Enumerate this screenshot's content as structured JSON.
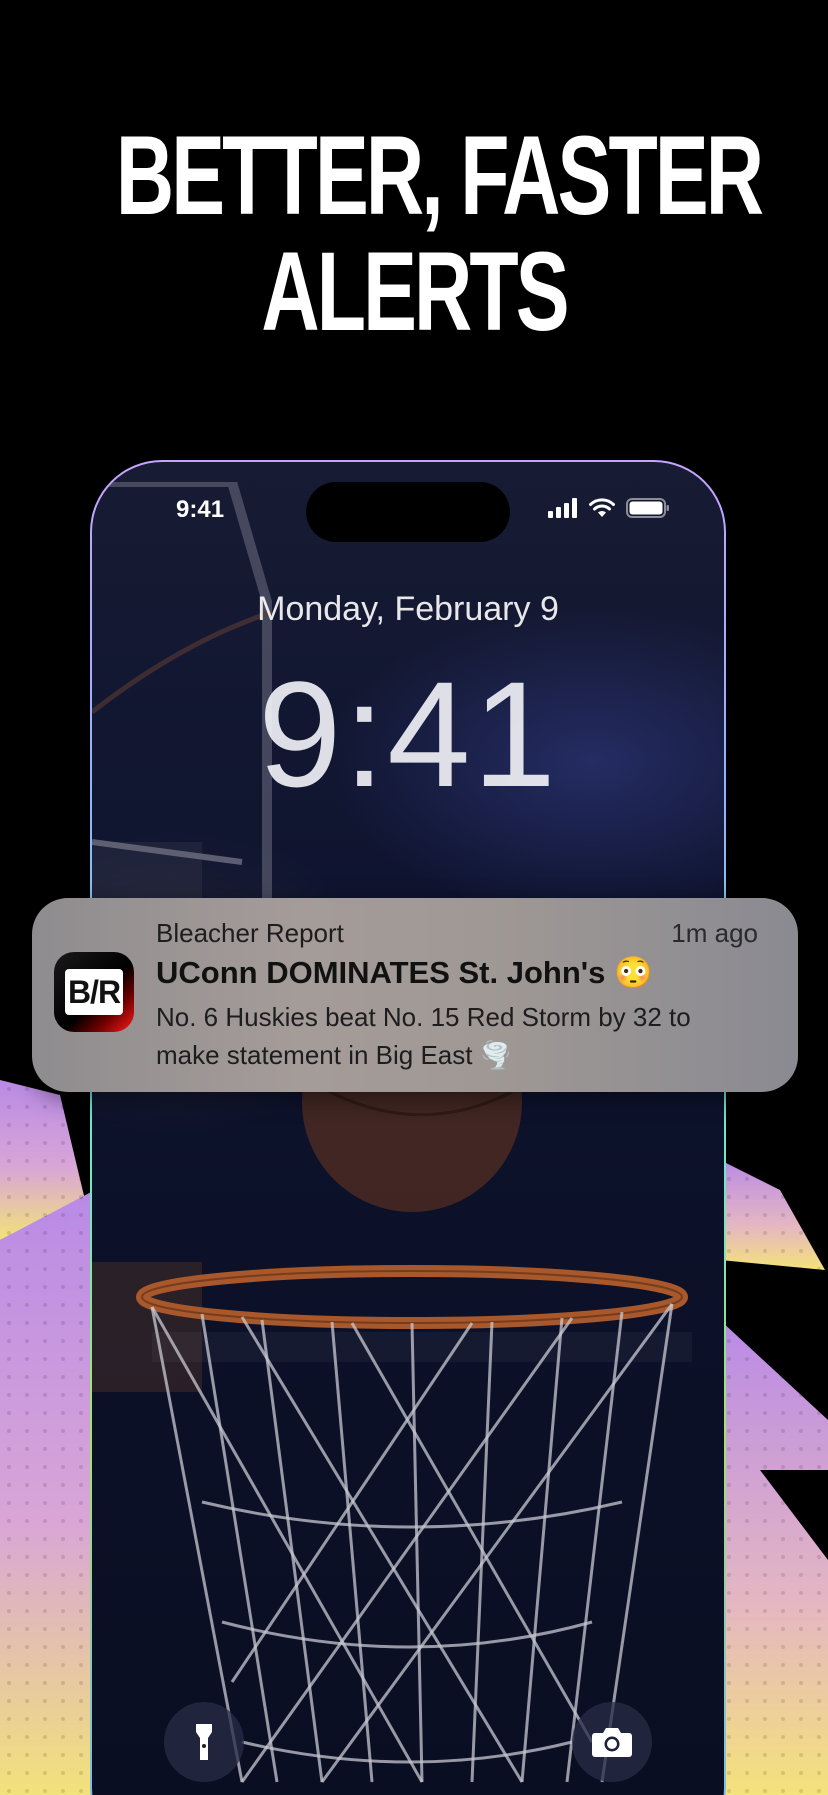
{
  "promo": {
    "headline_line1": "BETTER, FASTER",
    "headline_line2": "ALERTS"
  },
  "status_bar": {
    "time": "9:41",
    "icons": [
      "cellular-signal-icon",
      "wifi-icon",
      "battery-icon"
    ]
  },
  "lock_screen": {
    "date": "Monday, February 9",
    "time": "9:41",
    "bottom_left_icon": "flashlight-icon",
    "bottom_right_icon": "camera-icon"
  },
  "notification": {
    "app_name": "Bleacher Report",
    "icon_text": "B/R",
    "time_ago": "1m ago",
    "title": "UConn DOMINATES St. John's 😳",
    "body": "No. 6 Huskies beat No. 15 Red Storm by 32 to make statement in Big East 🌪️"
  },
  "colors": {
    "background": "#000000",
    "accent_purple": "#b98ae6",
    "accent_yellow": "#f4e27a",
    "brand_red": "#ff1a1a"
  }
}
